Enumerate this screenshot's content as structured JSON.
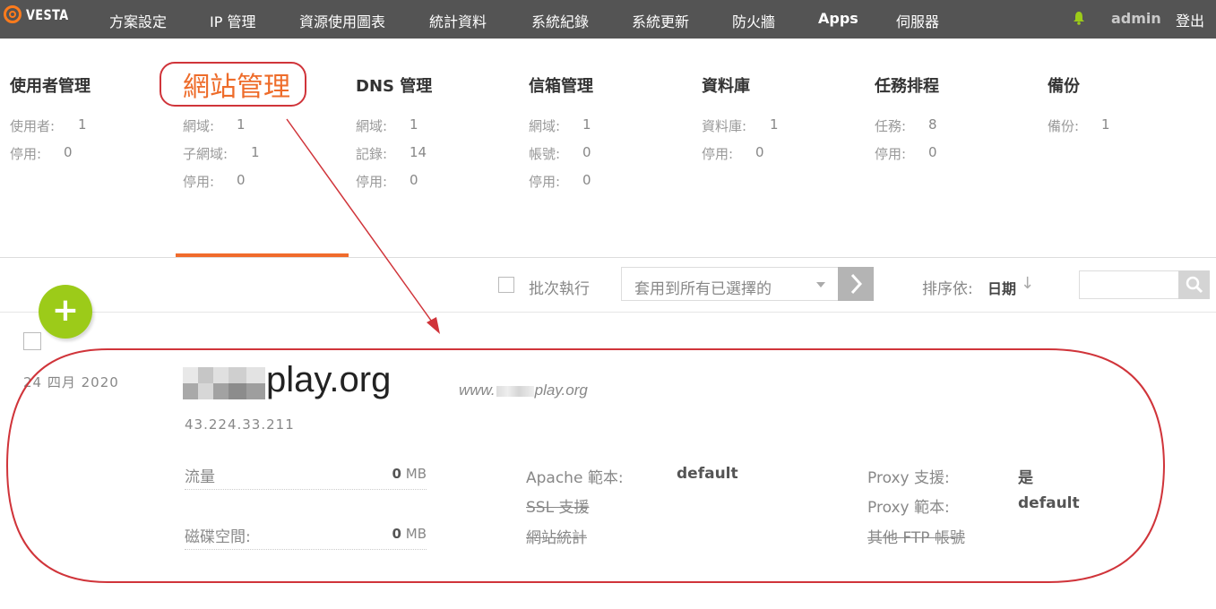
{
  "brand": {
    "name": "VESTA"
  },
  "nav": [
    {
      "label": "方案設定"
    },
    {
      "label": "IP 管理"
    },
    {
      "label": "資源使用圖表"
    },
    {
      "label": "統計資料"
    },
    {
      "label": "系統紀錄"
    },
    {
      "label": "系統更新"
    },
    {
      "label": "防火牆"
    },
    {
      "label": "Apps"
    },
    {
      "label": "伺服器"
    }
  ],
  "user": {
    "name": "admin",
    "logout": "登出"
  },
  "panels": [
    {
      "title": "使用者管理",
      "stats": [
        {
          "k": "使用者:",
          "v": "1"
        },
        {
          "k": "停用:",
          "v": "0"
        }
      ]
    },
    {
      "title": "網站管理",
      "stats": [
        {
          "k": "網域:",
          "v": "1"
        },
        {
          "k": "子網域:",
          "v": "1"
        },
        {
          "k": "停用:",
          "v": "0"
        }
      ]
    },
    {
      "title": "DNS 管理",
      "stats": [
        {
          "k": "網域:",
          "v": "1"
        },
        {
          "k": "記錄:",
          "v": "14"
        },
        {
          "k": "停用:",
          "v": "0"
        }
      ]
    },
    {
      "title": "信箱管理",
      "stats": [
        {
          "k": "網域:",
          "v": "1"
        },
        {
          "k": "帳號:",
          "v": "0"
        },
        {
          "k": "停用:",
          "v": "0"
        }
      ]
    },
    {
      "title": "資料庫",
      "stats": [
        {
          "k": "資料庫:",
          "v": "1"
        },
        {
          "k": "停用:",
          "v": "0"
        }
      ]
    },
    {
      "title": "任務排程",
      "stats": [
        {
          "k": "任務:",
          "v": "8"
        },
        {
          "k": "停用:",
          "v": "0"
        }
      ]
    },
    {
      "title": "備份",
      "stats": [
        {
          "k": "備份:",
          "v": "1"
        }
      ]
    }
  ],
  "toolbar": {
    "bulk_label": "批次執行",
    "select_value": "套用到所有已選擇的",
    "sort_label": "排序依:",
    "sort_value": "日期",
    "sort_arrow": "↓",
    "search_value": ""
  },
  "add_button": {
    "symbol": "+"
  },
  "row": {
    "date": "24  四月  2020",
    "domain_suffix": "play.org",
    "alias_prefix": "www.",
    "alias_suffix": "play.org",
    "ip": "43.224.33.211",
    "bandwidth_label": "流量",
    "bandwidth_value": "0",
    "bandwidth_unit": "MB",
    "disk_label": "磁碟空間:",
    "disk_value": "0",
    "disk_unit": "MB",
    "apache_label": "Apache 範本:",
    "apache_value": "default",
    "ssl_label": "SSL 支援",
    "stats_label": "網站統計",
    "proxy_support_label": "Proxy 支援:",
    "proxy_support_value": "是",
    "proxy_template_label": "Proxy 範本:",
    "proxy_template_value": "default",
    "ftp_label": "其他 FTP 帳號"
  },
  "colors": {
    "topbar": "#545454",
    "accent": "#ee6c2a",
    "add_button": "#9ccb19",
    "annotation": "#d0343a"
  }
}
